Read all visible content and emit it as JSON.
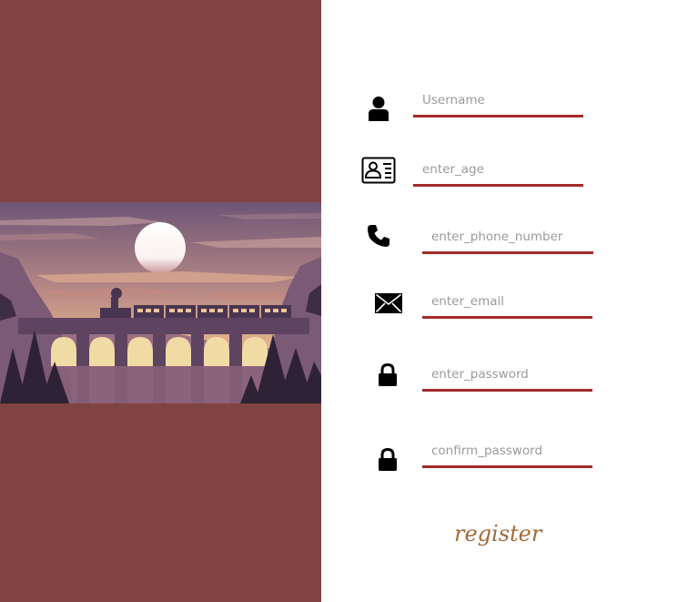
{
  "fields": [
    {
      "icon": "user-icon",
      "placeholder": "Username"
    },
    {
      "icon": "id-card-icon",
      "placeholder": "enter_age"
    },
    {
      "icon": "phone-icon",
      "placeholder": "enter_phone_number"
    },
    {
      "icon": "envelope-icon",
      "placeholder": "enter_email"
    },
    {
      "icon": "lock-icon",
      "placeholder": "enter_password"
    },
    {
      "icon": "lock-icon",
      "placeholder": "confirm_password"
    }
  ],
  "register_label": "register",
  "colors": {
    "panel": "#814242",
    "underline": "#a52a2a",
    "register": "#a06a3a"
  }
}
